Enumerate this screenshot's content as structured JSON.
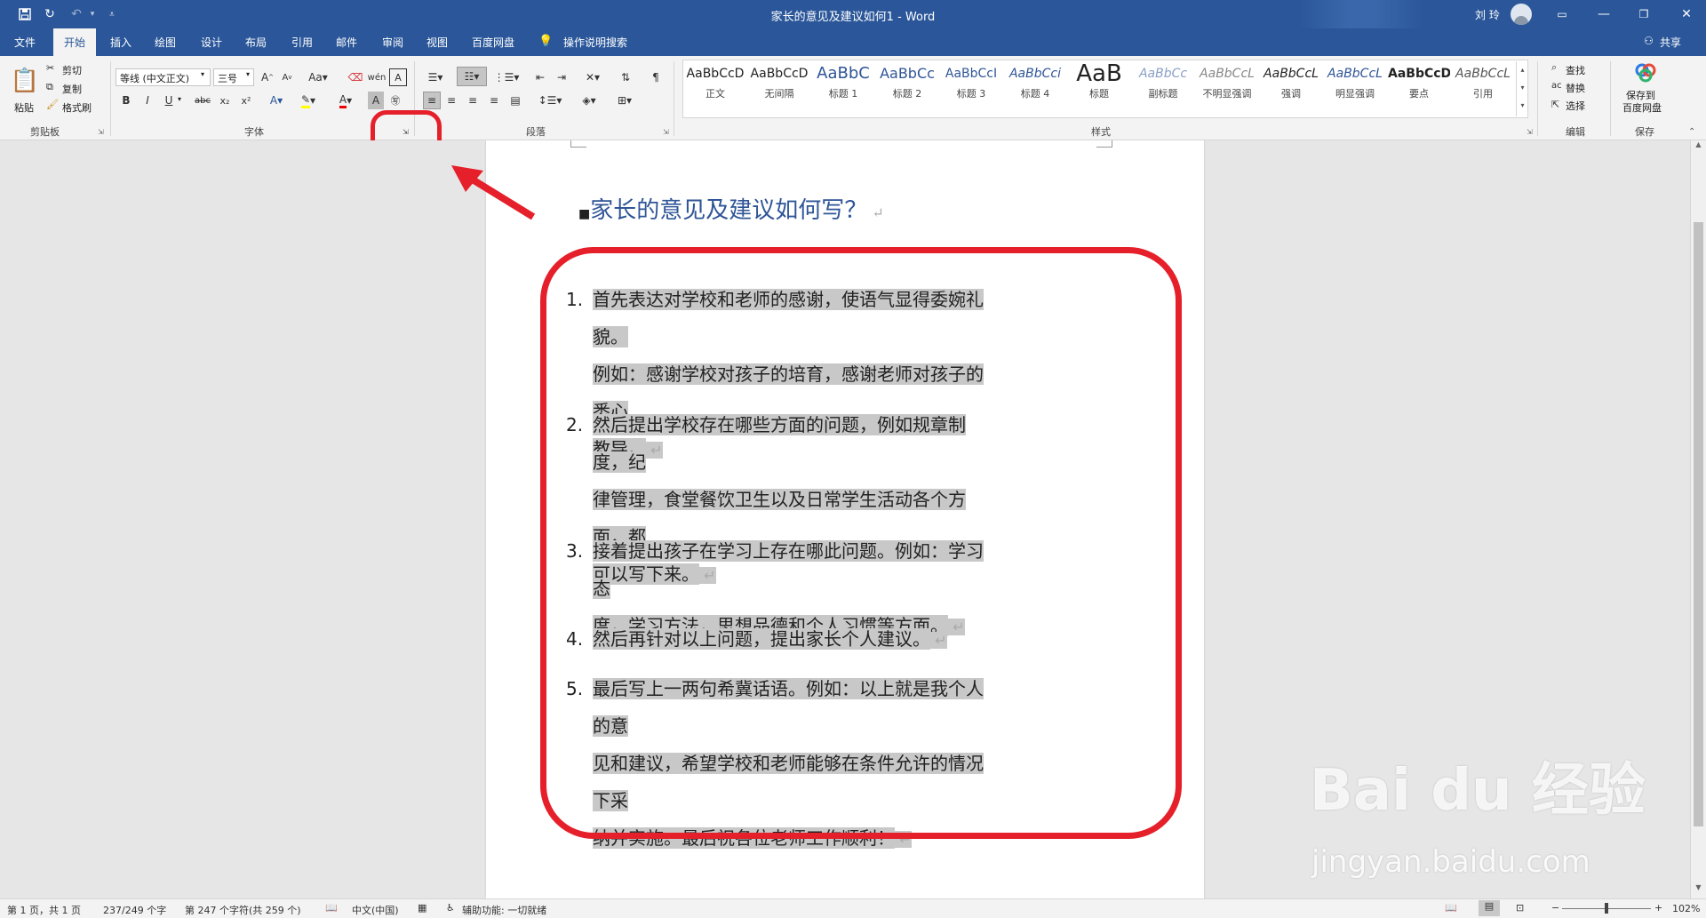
{
  "window": {
    "title": "家长的意见及建议如何1 - Word",
    "user": "刘 玲"
  },
  "tabs": [
    "文件",
    "开始",
    "插入",
    "绘图",
    "设计",
    "布局",
    "引用",
    "邮件",
    "审阅",
    "视图",
    "百度网盘"
  ],
  "tell_me": "操作说明搜索",
  "share": "共享",
  "clipboard": {
    "paste": "粘贴",
    "cut": "剪切",
    "copy": "复制",
    "format_painter": "格式刷",
    "label": "剪贴板"
  },
  "font": {
    "name": "等线 (中文正文)",
    "size": "三号",
    "label": "字体",
    "bold": "B",
    "italic": "I",
    "underline": "U",
    "strike": "abc",
    "sub": "x₂",
    "sup": "x²"
  },
  "paragraph": {
    "label": "段落"
  },
  "styles": {
    "label": "样式",
    "items": [
      {
        "sample": "AaBbCcD",
        "name": "正文"
      },
      {
        "sample": "AaBbCcD",
        "name": "无间隔"
      },
      {
        "sample": "AaBbC",
        "name": "标题 1"
      },
      {
        "sample": "AaBbCc",
        "name": "标题 2"
      },
      {
        "sample": "AaBbCcI",
        "name": "标题 3"
      },
      {
        "sample": "AaBbCci",
        "name": "标题 4"
      },
      {
        "sample": "AaB",
        "name": "标题"
      },
      {
        "sample": "AaBbCc",
        "name": "副标题"
      },
      {
        "sample": "AaBbCcL",
        "name": "不明显强调"
      },
      {
        "sample": "AaBbCcL",
        "name": "强调"
      },
      {
        "sample": "AaBbCcL",
        "name": "明显强调"
      },
      {
        "sample": "AaBbCcD",
        "name": "要点"
      },
      {
        "sample": "AaBbCcL",
        "name": "引用"
      }
    ]
  },
  "editing": {
    "find": "查找",
    "replace": "替换",
    "select": "选择",
    "label": "编辑"
  },
  "save": {
    "line1": "保存到",
    "line2": "百度网盘",
    "label": "保存"
  },
  "document": {
    "heading": "家长的意见及建议如何写？",
    "items": [
      {
        "num": "1.",
        "lines": [
          "首先表达对学校和老师的感谢，使语气显得委婉礼貌。",
          "例如：感谢学校对孩子的培育，感谢老师对孩子的悉心",
          "教导。"
        ]
      },
      {
        "num": "2.",
        "lines": [
          "然后提出学校存在哪些方面的问题，例如规章制度，纪",
          "律管理，食堂餐饮卫生以及日常学生活动各个方面，都",
          "可以写下来。"
        ]
      },
      {
        "num": "3.",
        "lines": [
          "接着提出孩子在学习上存在哪此问题。例如：学习态",
          "度，学习方法，思想品德和个人习惯等方面。"
        ]
      },
      {
        "num": "4.",
        "lines": [
          "然后再针对以上问题，提出家长个人建议。"
        ]
      },
      {
        "num": "5.",
        "lines": [
          "最后写上一两句希冀话语。例如：以上就是我个人的意",
          "见和建议，希望学校和老师能够在条件允许的情况下采",
          "纳并实施。最后祝各位老师工作顺利！"
        ]
      }
    ]
  },
  "statusbar": {
    "page": "第 1 页，共 1 页",
    "words": "237/249 个字",
    "chars": "第 247 个字符(共 259 个)",
    "lang": "中文(中国)",
    "access": "辅助功能: 一切就绪",
    "zoom": "102%"
  },
  "watermark": {
    "brand": "Bai du 经验",
    "url": "jingyan.baidu.com"
  },
  "colors": {
    "word_blue": "#2b579a",
    "heading_blue": "#2f5597",
    "annotation_red": "#e5202a"
  }
}
